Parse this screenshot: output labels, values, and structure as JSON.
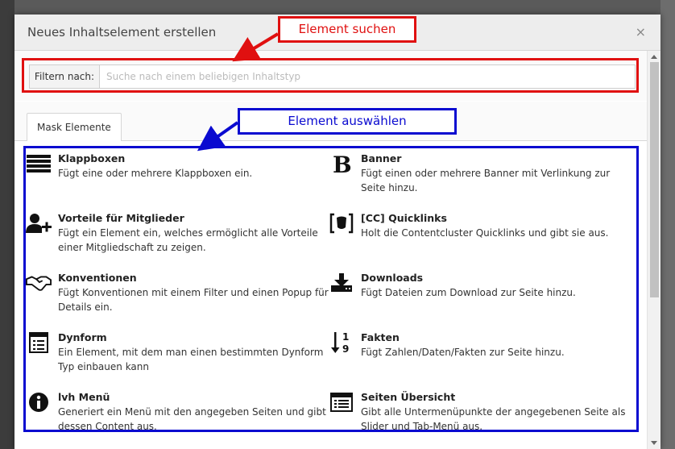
{
  "dialog": {
    "title": "Neues Inhaltselement erstellen",
    "close": "×"
  },
  "filter": {
    "label": "Filtern nach:",
    "placeholder": "Suche nach einem beliebigen Inhaltstyp",
    "value": ""
  },
  "tabs": [
    {
      "label": "Mask Elemente",
      "active": true
    }
  ],
  "elements": [
    {
      "name": "Klappboxen",
      "icon": "list-bars-icon",
      "desc": "Fügt eine oder mehrere Klappboxen ein."
    },
    {
      "name": "Banner",
      "icon": "bold-b-icon",
      "desc": "Fügt einen oder mehrere Banner mit Verlinkung zur Seite hinzu."
    },
    {
      "name": "Vorteile für Mitglieder",
      "icon": "user-plus-icon",
      "desc": "Fügt ein Element ein, welches ermöglicht alle Vorteile einer Mitgliedschaft zu zeigen."
    },
    {
      "name": "[CC] Quicklinks",
      "icon": "bracket-logo-icon",
      "desc": "Holt die Contentcluster Quicklinks und gibt sie aus."
    },
    {
      "name": "Konventionen",
      "icon": "handshake-icon",
      "desc": "Fügt Konventionen mit einem Filter und einen Popup für Details ein."
    },
    {
      "name": "Downloads",
      "icon": "download-icon",
      "desc": "Fügt Dateien zum Download zur Seite hinzu."
    },
    {
      "name": "Dynform",
      "icon": "form-icon",
      "desc": "Ein Element, mit dem man einen bestimmten Dynform Typ einbauen kann"
    },
    {
      "name": "Fakten",
      "icon": "sort-numeric-icon",
      "desc": "Fügt Zahlen/Daten/Fakten zur Seite hinzu."
    },
    {
      "name": "lvh Menü",
      "icon": "info-icon",
      "desc": "Generiert ein Menü mit den angegeben Seiten und gibt dessen Content aus."
    },
    {
      "name": "Seiten Übersicht",
      "icon": "list-alt-icon",
      "desc": "Gibt alle Untermenüpunkte der angegebenen Seite als Slider und Tab-Menü aus."
    }
  ],
  "annotations": {
    "search_label": "Element suchen",
    "select_label": "Element auswählen",
    "red": "#e01010",
    "blue": "#0a0ad0"
  }
}
